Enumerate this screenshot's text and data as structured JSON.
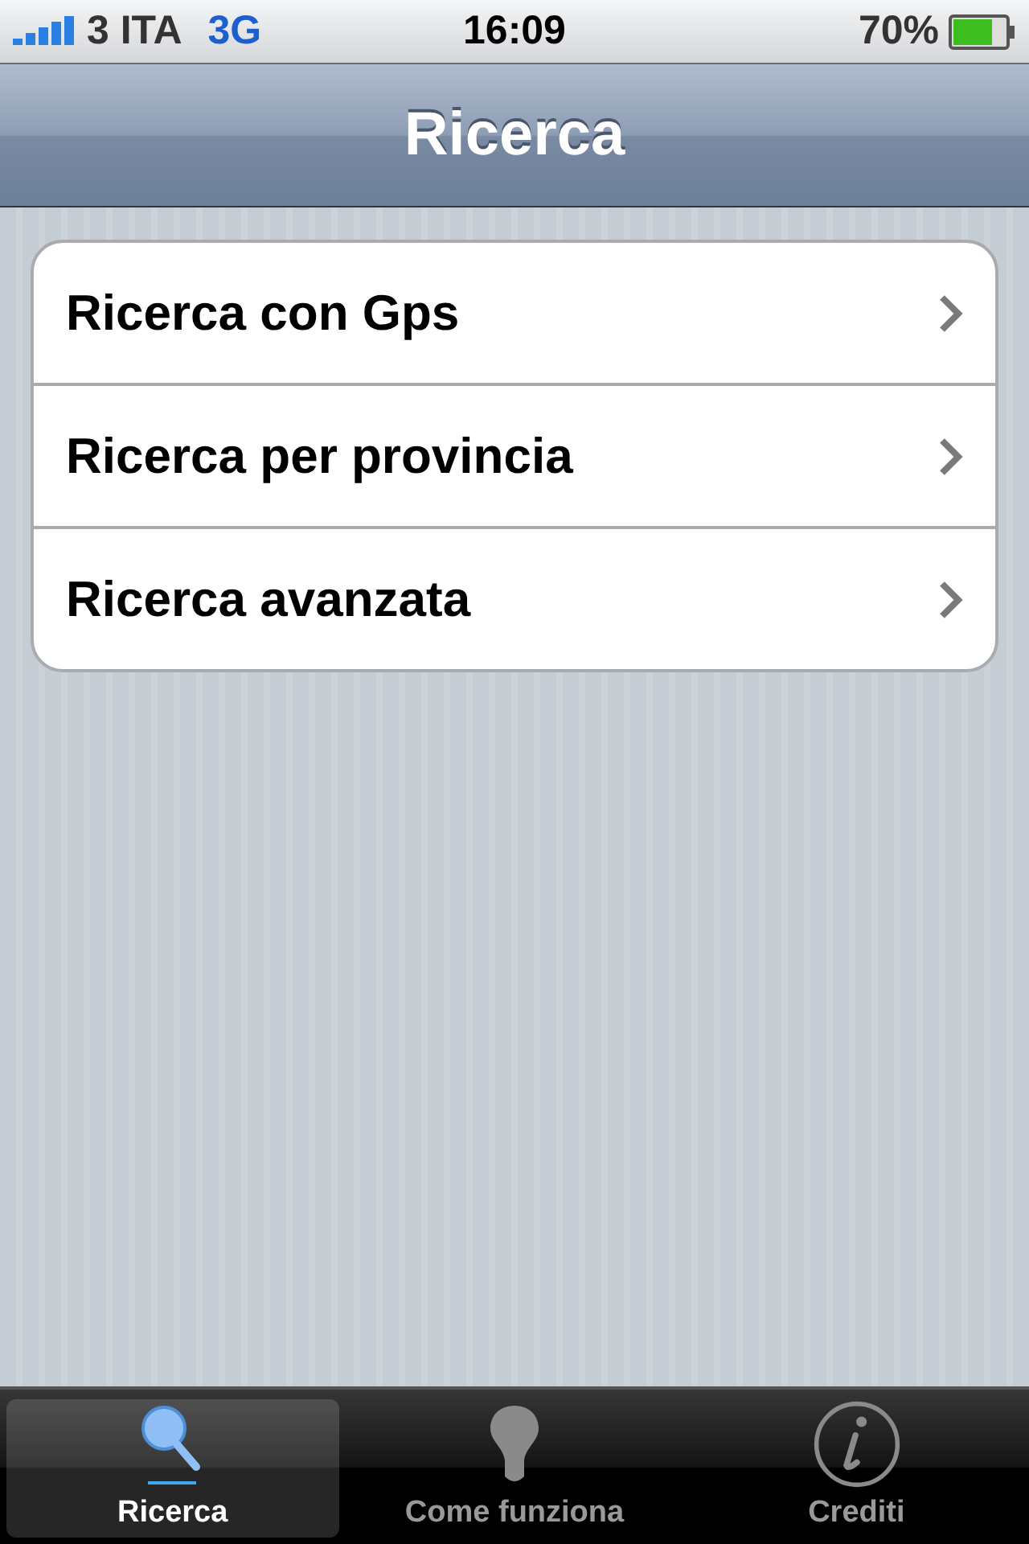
{
  "status_bar": {
    "carrier": "3 ITA",
    "network": "3G",
    "time": "16:09",
    "battery": "70%"
  },
  "nav_bar": {
    "title": "Ricerca"
  },
  "menu": [
    {
      "label": "Ricerca con Gps"
    },
    {
      "label": "Ricerca per provincia"
    },
    {
      "label": "Ricerca avanzata"
    }
  ],
  "tab_bar": [
    {
      "label": "Ricerca",
      "kind": "search",
      "selected": true
    },
    {
      "label": "Come funziona",
      "kind": "bulb",
      "selected": false
    },
    {
      "label": "Crediti",
      "kind": "info",
      "selected": false
    }
  ]
}
